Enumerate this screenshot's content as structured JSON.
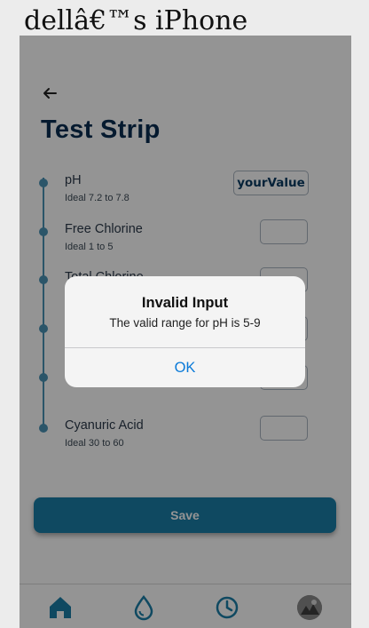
{
  "window": {
    "title": "dellâ€™s iPhone"
  },
  "header": {
    "title": "Test Strip"
  },
  "parameters": [
    {
      "name": "pH",
      "ideal": "Ideal 7.2 to 7.8",
      "value": "yourValue"
    },
    {
      "name": "Free Chlorine",
      "ideal": "Ideal 1 to 5",
      "value": ""
    },
    {
      "name": "Total Chlorine",
      "ideal": "",
      "value": ""
    },
    {
      "name": "",
      "ideal": "",
      "value": ""
    },
    {
      "name": "",
      "ideal": "",
      "value": ""
    },
    {
      "name": "Cyanuric Acid",
      "ideal": "Ideal 30 to 60",
      "value": ""
    }
  ],
  "actions": {
    "save_label": "Save"
  },
  "tabs": [
    {
      "icon": "home-icon"
    },
    {
      "icon": "water-drop-icon"
    },
    {
      "icon": "clock-icon"
    },
    {
      "icon": "avatar"
    }
  ],
  "alert": {
    "title": "Invalid Input",
    "message": "The valid range for pH is 5-9",
    "ok_label": "OK"
  },
  "colors": {
    "primary": "#1a7ea8",
    "title": "#0a2d52",
    "timeline": "#4a93b6",
    "alert_button": "#0a7ad8"
  }
}
